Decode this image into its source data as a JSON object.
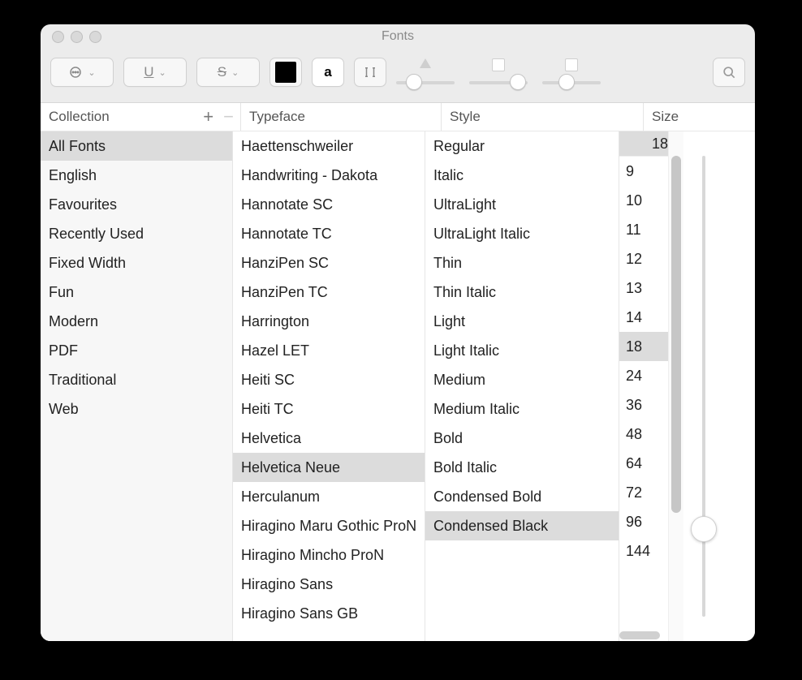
{
  "window": {
    "title": "Fonts"
  },
  "toolbar": {
    "effects_icon": "…",
    "underline_icon": "U",
    "strike_icon": "S",
    "char_icon": "a"
  },
  "headers": {
    "collection": "Collection",
    "typeface": "Typeface",
    "style": "Style",
    "size": "Size"
  },
  "collections": {
    "selected_index": 0,
    "items": [
      "All Fonts",
      "English",
      "Favourites",
      "Recently Used",
      "Fixed Width",
      "Fun",
      "Modern",
      "PDF",
      "Traditional",
      "Web"
    ]
  },
  "typefaces": {
    "selected_index": 11,
    "items": [
      "Haettenschweiler",
      "Handwriting - Dakota",
      "Hannotate SC",
      "Hannotate TC",
      "HanziPen SC",
      "HanziPen TC",
      "Harrington",
      "Hazel LET",
      "Heiti SC",
      "Heiti TC",
      "Helvetica",
      "Helvetica Neue",
      "Herculanum",
      "Hiragino Maru Gothic ProN",
      "Hiragino Mincho ProN",
      "Hiragino Sans",
      "Hiragino Sans GB"
    ]
  },
  "styles": {
    "selected_index": 13,
    "items": [
      "Regular",
      "Italic",
      "UltraLight",
      "UltraLight Italic",
      "Thin",
      "Thin Italic",
      "Light",
      "Light Italic",
      "Medium",
      "Medium Italic",
      "Bold",
      "Bold Italic",
      "Condensed Bold",
      "Condensed Black"
    ]
  },
  "size": {
    "current": "18",
    "selected_index": 6,
    "presets": [
      "9",
      "10",
      "11",
      "12",
      "13",
      "14",
      "18",
      "24",
      "36",
      "48",
      "64",
      "72",
      "96",
      "144"
    ]
  }
}
